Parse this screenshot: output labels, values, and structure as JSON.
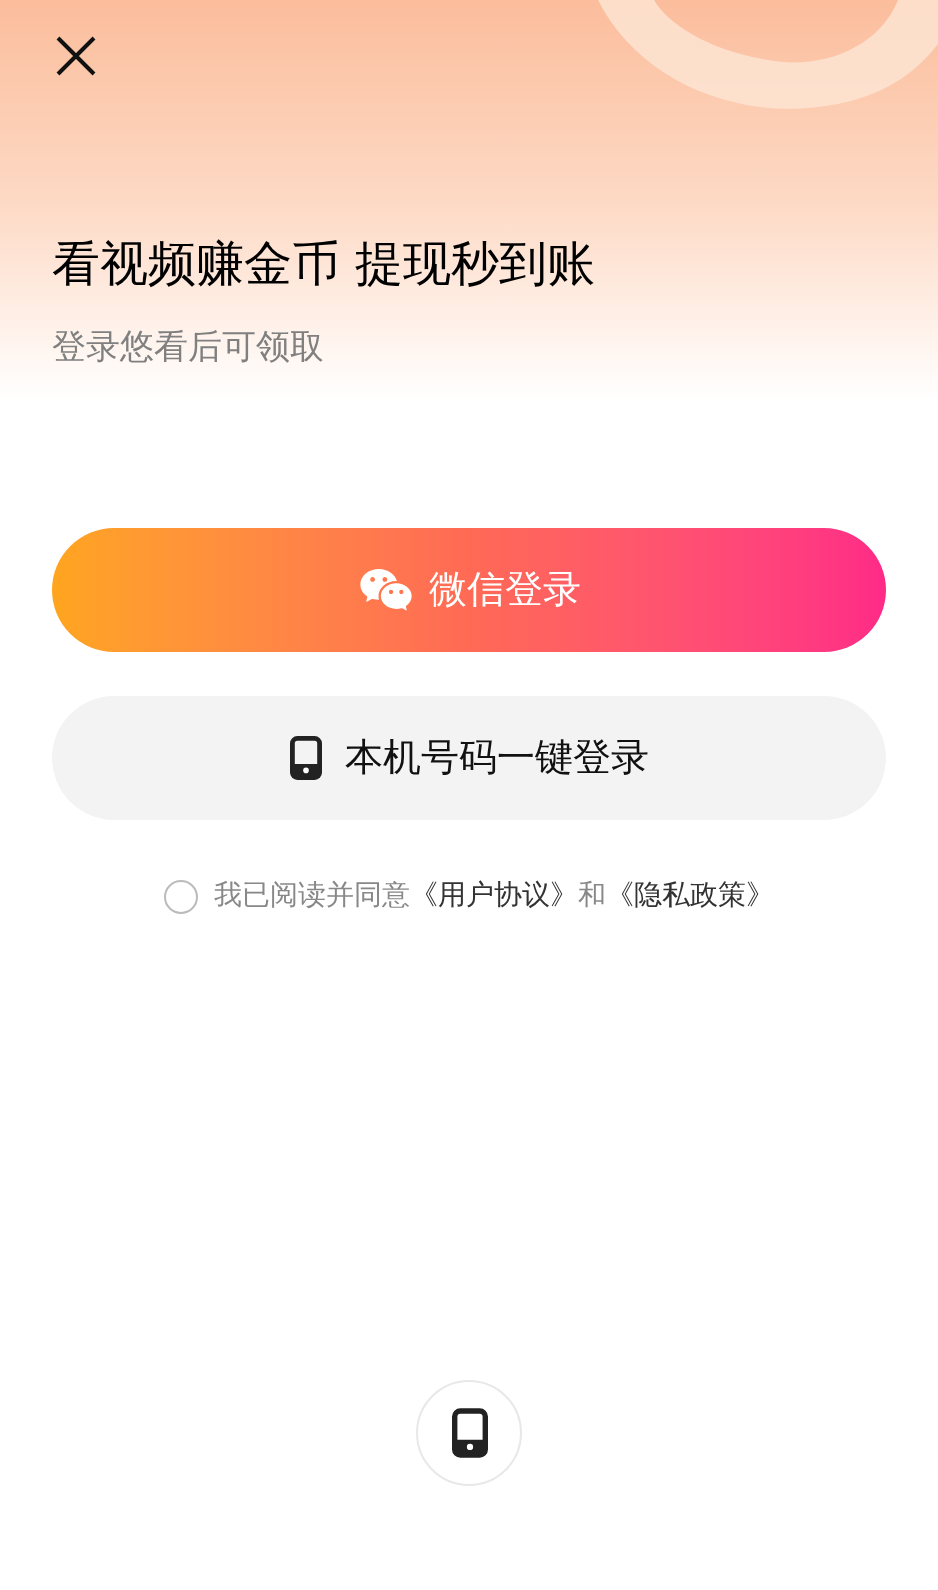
{
  "headline": "看视频赚金币 提现秒到账",
  "subtitle": "登录悠看后可领取",
  "buttons": [
    {
      "kind": "wechat",
      "label": "微信登录"
    },
    {
      "kind": "phone",
      "label": "本机号码一键登录"
    }
  ],
  "agreement": {
    "checked": false,
    "parts": [
      {
        "kind": "text",
        "text": "我已阅读并同意"
      },
      {
        "kind": "link",
        "text": "《用户协议》"
      },
      {
        "kind": "text",
        "text": "和"
      },
      {
        "kind": "link",
        "text": "《隐私政策》"
      }
    ]
  }
}
